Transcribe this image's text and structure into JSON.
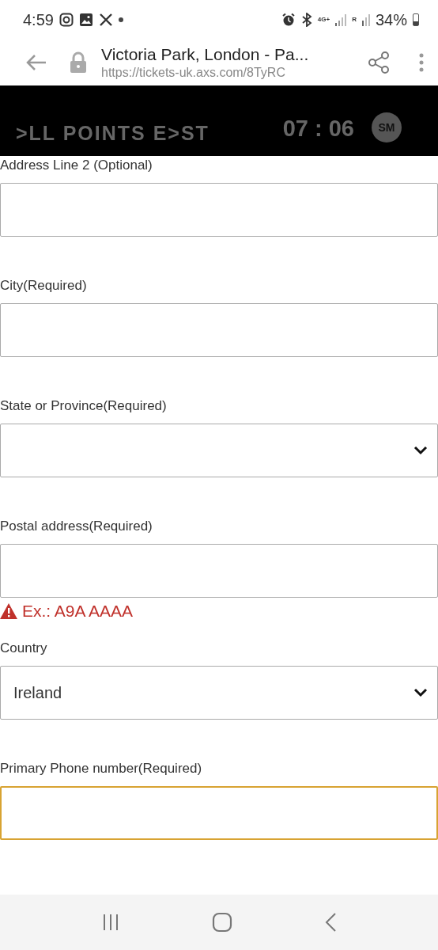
{
  "status_bar": {
    "time": "4:59",
    "network": "4G+",
    "roaming": "R",
    "battery": "34%"
  },
  "browser": {
    "title": "Victoria Park, London - Pa...",
    "url": "https://tickets-uk.axs.com/8TyRC"
  },
  "header": {
    "logo": ">LL POINTS E>ST",
    "timer": "07 : 06",
    "avatar": "SM"
  },
  "fields": [
    {
      "kind": "text",
      "label": "Address Line 2 (Optional)",
      "focused": false
    },
    {
      "kind": "text",
      "label": "City(Required)",
      "focused": false
    },
    {
      "kind": "select",
      "label": "State or Province(Required)",
      "focused": false
    },
    {
      "kind": "text",
      "label": "Postal address(Required)",
      "focused": false,
      "error": "Ex.: A9A AAAA"
    },
    {
      "kind": "select",
      "label": "Country",
      "value": "Ireland",
      "focused": false
    },
    {
      "kind": "text",
      "label": "Primary Phone number(Required)",
      "focused": true
    }
  ]
}
